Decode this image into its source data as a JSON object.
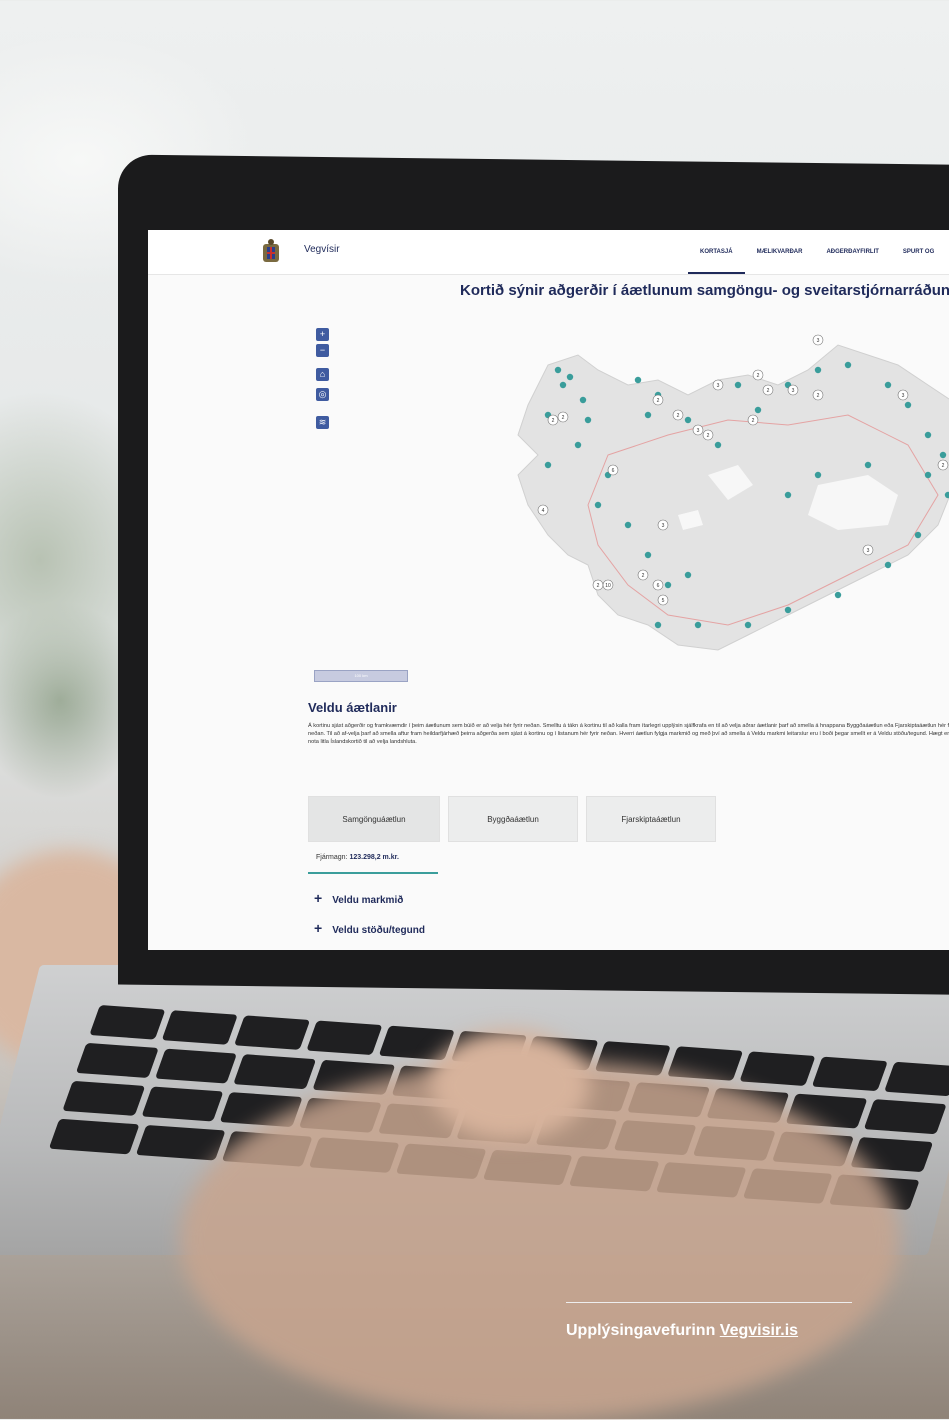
{
  "site": {
    "brand": "Vegvísir",
    "nav": [
      "KORTASJÁ",
      "MÆLIKVARÐAR",
      "AÐGERÐAYFIRLIT",
      "SPURT OG"
    ],
    "active_nav": "KORTASJÁ"
  },
  "map_section": {
    "title": "Kortið sýnir aðgerðir í áætlunum samgöngu- og sveitarstjórnarráðun",
    "controls": [
      "+",
      "−",
      "⌂",
      "◎",
      "≋"
    ],
    "scalebar_label": "100 km",
    "cluster_counts": [
      "3",
      "2",
      "2",
      "2",
      "3",
      "2",
      "2",
      "3",
      "2",
      "2",
      "2",
      "3",
      "2",
      "6",
      "4",
      "3",
      "2",
      "10",
      "2",
      "6",
      "5",
      "3",
      "3",
      "2"
    ]
  },
  "plans_section": {
    "title": "Veldu áætlanir",
    "paragraph": "Á kortinu sjást aðgerðir og framkvæmdir í þeim áætlunum sem búið er að velja hér fyrir neðan. Smelltu á tákn á kortinu til að kalla fram ítarlegri upplýsin sjálfkrafa en til að velja aðrar áætlanir þarf að smella á hnappana Byggðaáætlun eða Fjarskiptaáætlun hér fyrir neðan. Til að af-velja þarf að smella aftur fram heildarfjárhæð þeirra aðgerða sem sjást á kortinu og í listanum hér fyrir neðan. Hverri áætlun fylgja markmið og með því að smella á Veldu markmi leitarsíur eru í boði þegar smellt er á Veldu stöðu/tegund. Hægt er að nota litla Íslandskortið til að velja landshluta.",
    "plan_buttons": [
      "Samgönguáætlun",
      "Byggðaáætlun",
      "Fjarskiptaáætlun"
    ],
    "funding_label": "Fjármagn:",
    "funding_value": "123.298,2 m.kr.",
    "expanders": [
      "Veldu markmið",
      "Veldu stöðu/tegund"
    ]
  },
  "caption": {
    "prefix": "Upplýsingavefurinn ",
    "link": "Vegvisir.is"
  },
  "colors": {
    "brand_navy": "#1f2a5a",
    "teal": "#3a9d9b",
    "control_blue": "#3f5ba0"
  }
}
